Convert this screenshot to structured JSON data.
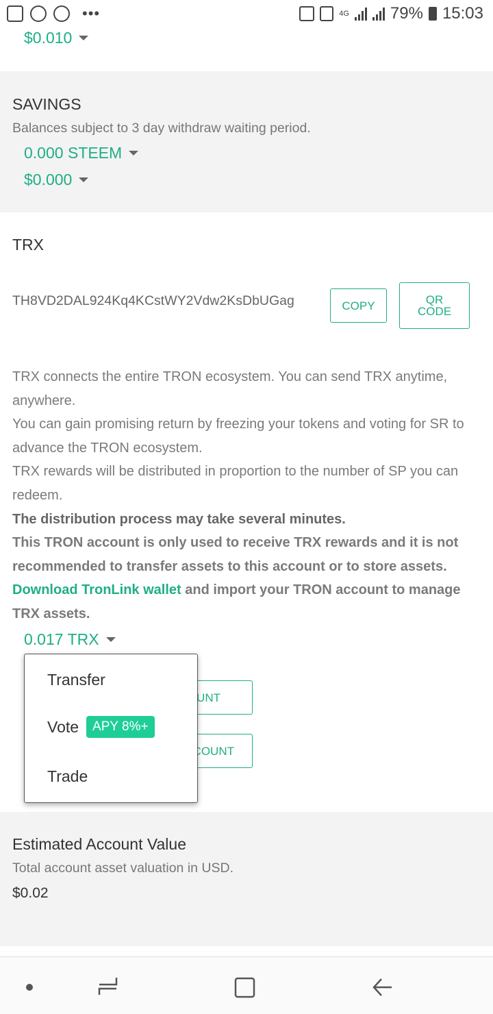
{
  "status_bar": {
    "network": "4G",
    "battery": "79%",
    "time": "15:03",
    "more": "•••"
  },
  "top_amount": "$0.010",
  "savings": {
    "title": "SAVINGS",
    "subtitle": "Balances subject to 3 day withdraw waiting period.",
    "steem_amount": "0.000 STEEM",
    "usd_amount": "$0.000"
  },
  "trx": {
    "title": "TRX",
    "address": "TH8VD2DAL924Kq4KCstWY2Vdw2KsDbUGag",
    "copy_label": "COPY",
    "qr_label_line1": "QR",
    "qr_label_line2": "CODE",
    "desc_1": "TRX connects the entire TRON ecosystem. You can send TRX anytime, anywhere.",
    "desc_2": "You can gain promising return by freezing your tokens and voting for SR to advance the TRON ecosystem.",
    "desc_3": "TRX rewards will be distributed in proportion to the number of SP you can redeem.",
    "desc_4": "The distribution process may take several minutes.",
    "desc_5": "This TRON account is only used to receive TRX rewards and it is not recommended to transfer assets to this account or to store assets.",
    "download_link": "Download TronLink wallet",
    "desc_6": " and import your TRON account to manage TRX assets.",
    "balance": "0.017 TRX",
    "btn1_visible": "UNT",
    "btn2_visible": "COUNT"
  },
  "menu": {
    "transfer": "Transfer",
    "vote": "Vote",
    "apy_badge": "APY 8%+",
    "trade": "Trade"
  },
  "estimated": {
    "title": "Estimated Account Value",
    "subtitle": "Total account asset valuation in USD.",
    "value": "$0.02"
  },
  "colors": {
    "accent": "#1fae86",
    "badge": "#1fce96",
    "grey_bg": "#f3f3f3"
  }
}
